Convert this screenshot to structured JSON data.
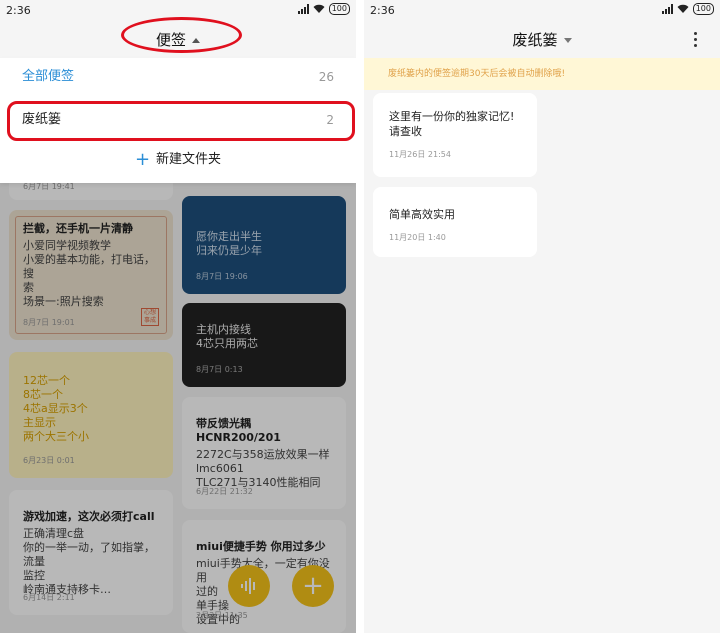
{
  "status": {
    "time": "2:36",
    "battery": "100"
  },
  "left": {
    "title": "便签",
    "dropdown": {
      "items": [
        {
          "label": "全部便签",
          "count": "26"
        },
        {
          "label": "废纸篓",
          "count": "2"
        }
      ],
      "new_folder": "新建文件夹"
    },
    "notes": [
      {
        "lines": [
          "6月7日 19:41"
        ],
        "date": ""
      },
      {
        "title": "拦截，还手机一片清静",
        "lines": [
          "小爱同学视频教学",
          "小爱的基本功能，打电话，搜",
          "索",
          "场景一:照片搜索"
        ],
        "date": "8月7日 19:01",
        "stamp": "心想事成"
      },
      {
        "lines": [
          "12芯一个",
          "8芯一个",
          "4芯a显示3个",
          "主显示",
          "两个大三个小"
        ],
        "date": "6月23日 0:01"
      },
      {
        "title": "游戏加速，这次必须打call",
        "lines": [
          "正确清理c盘",
          "你的一举一动，了如指掌，流量",
          "监控",
          "岭南通支持移卡…"
        ],
        "date": "6月14日 2:11"
      },
      {
        "lines": [
          "愿你走出半生",
          "归来仍是少年"
        ],
        "date": "8月7日 19:06"
      },
      {
        "title": "主机内接线",
        "lines": [
          "4芯只用两芯"
        ],
        "date": "8月7日 0:13"
      },
      {
        "title": "带反馈光耦HCNR200/201",
        "lines": [
          "2272C与358运放效果一样",
          "lmc6061",
          "TLC271与3140性能相同"
        ],
        "date": "6月22日 21:32"
      },
      {
        "title": "miui便捷手势  你用过多少",
        "lines": [
          "miui手势大全，一定有你没用",
          "过的",
          "单手操",
          "设置中的"
        ],
        "date": "2月3日 11:35"
      }
    ],
    "fab_voice": "voice-wave-icon",
    "fab_add": "+"
  },
  "right": {
    "title": "废纸篓",
    "notice": "废纸篓内的便签逾期30天后会被自动删除哦!",
    "notes": [
      {
        "text": "这里有一份你的独家记忆!请查收",
        "date": "11月26日 21:54"
      },
      {
        "text": "简单高效实用",
        "date": "11月20日 1:40"
      }
    ]
  },
  "colors": {
    "accent": "#2b8ed6",
    "highlight": "#e0101e",
    "fab": "#f4c21a",
    "notice_text": "#e0a24a"
  }
}
